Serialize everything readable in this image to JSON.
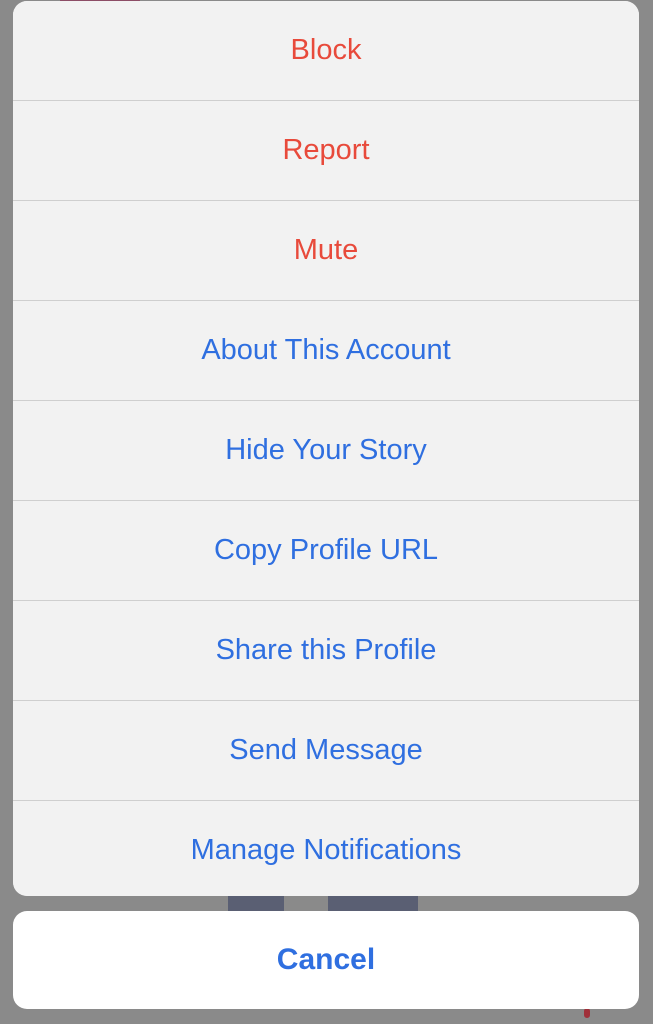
{
  "action_sheet": {
    "items": [
      {
        "label": "Block",
        "style": "destructive"
      },
      {
        "label": "Report",
        "style": "destructive"
      },
      {
        "label": "Mute",
        "style": "destructive"
      },
      {
        "label": "About This Account",
        "style": "default"
      },
      {
        "label": "Hide Your Story",
        "style": "default"
      },
      {
        "label": "Copy Profile URL",
        "style": "default"
      },
      {
        "label": "Share this Profile",
        "style": "default"
      },
      {
        "label": "Send Message",
        "style": "default"
      },
      {
        "label": "Manage Notifications",
        "style": "default"
      }
    ],
    "cancel_label": "Cancel"
  },
  "colors": {
    "destructive": "#e84a3b",
    "default": "#2f6fe0",
    "sheet_background": "#f2f2f2",
    "cancel_background": "#ffffff",
    "dim_overlay": "#8a8a8a"
  }
}
